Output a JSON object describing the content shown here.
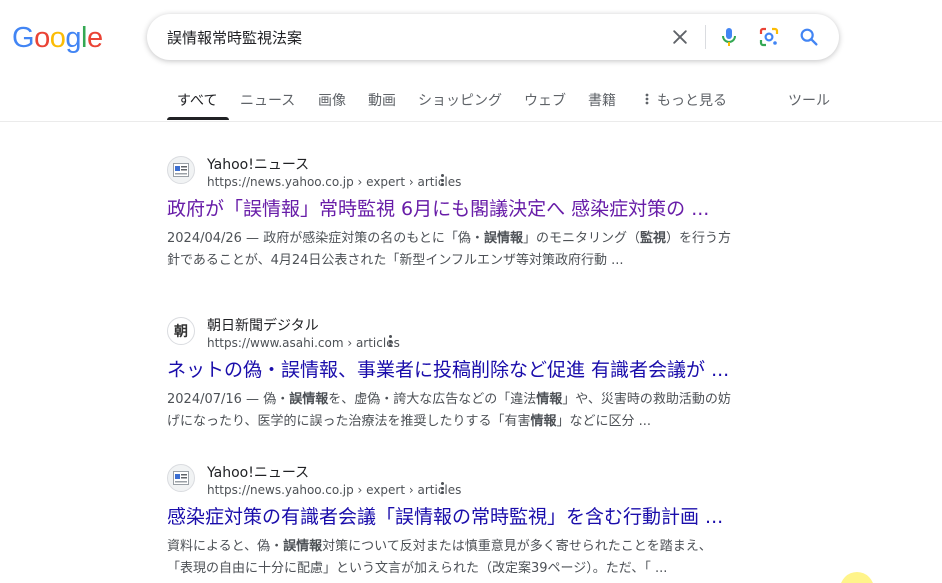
{
  "logo": {
    "letters": [
      "G",
      "o",
      "o",
      "g",
      "l",
      "e"
    ],
    "colors": [
      "#4285F4",
      "#EA4335",
      "#FBBC05",
      "#4285F4",
      "#34A853",
      "#EA4335"
    ]
  },
  "search": {
    "query": "誤情報常時監視法案"
  },
  "tabs": [
    {
      "label": "すべて",
      "active": true
    },
    {
      "label": "ニュース"
    },
    {
      "label": "画像"
    },
    {
      "label": "動画"
    },
    {
      "label": "ショッピング"
    },
    {
      "label": "ウェブ"
    },
    {
      "label": "書籍"
    },
    {
      "label": "もっと見る"
    }
  ],
  "tools_label": "ツール",
  "results": [
    {
      "site": "Yahoo!ニュース",
      "url": "https://news.yahoo.co.jp › expert › articles",
      "favicon": "yahoo-news-icon",
      "title": "政府が「誤情報」常時監視 6月にも閣議決定へ 感染症対策の ...",
      "visited": true,
      "snippet_line1": [
        "2024/04/26 — 政府が感染症対策の名のもとに「偽・",
        "誤情報",
        "」のモニタリング（",
        "監視",
        "）を行う方"
      ],
      "snippet_line2": "針であることが、4月24日公表された「新型インフルエンザ等対策政府行動 ..."
    },
    {
      "site": "朝日新聞デジタル",
      "url": "https://www.asahi.com › articles",
      "favicon": "asahi-icon",
      "favicon_text": "朝",
      "title": "ネットの偽・誤情報、事業者に投稿削除など促進 有識者会議が ...",
      "visited": false,
      "snippet_line1": [
        "2024/07/16 — 偽・",
        "誤情報",
        "を、虚偽・誇大な広告などの「違法",
        "情報",
        "」や、災害時の救助活動の妨"
      ],
      "snippet_line2": [
        "げになったり、医学的に誤った治療法を推奨したりする「有害",
        "情報",
        "」などに区分 ..."
      ]
    },
    {
      "site": "Yahoo!ニュース",
      "url": "https://news.yahoo.co.jp › expert › articles",
      "favicon": "yahoo-news-icon",
      "title": "感染症対策の有識者会議「誤情報の常時監視」を含む行動計画 ...",
      "visited": false,
      "snippet_line1": [
        "資料によると、偽・",
        "誤情報",
        "対策について反対または慎重意見が多く寄せられたことを踏まえ、"
      ],
      "snippet_line2": "「表現の自由に十分に配慮」という文言が加えられた（改定案39ページ）。ただ、「 ..."
    }
  ]
}
